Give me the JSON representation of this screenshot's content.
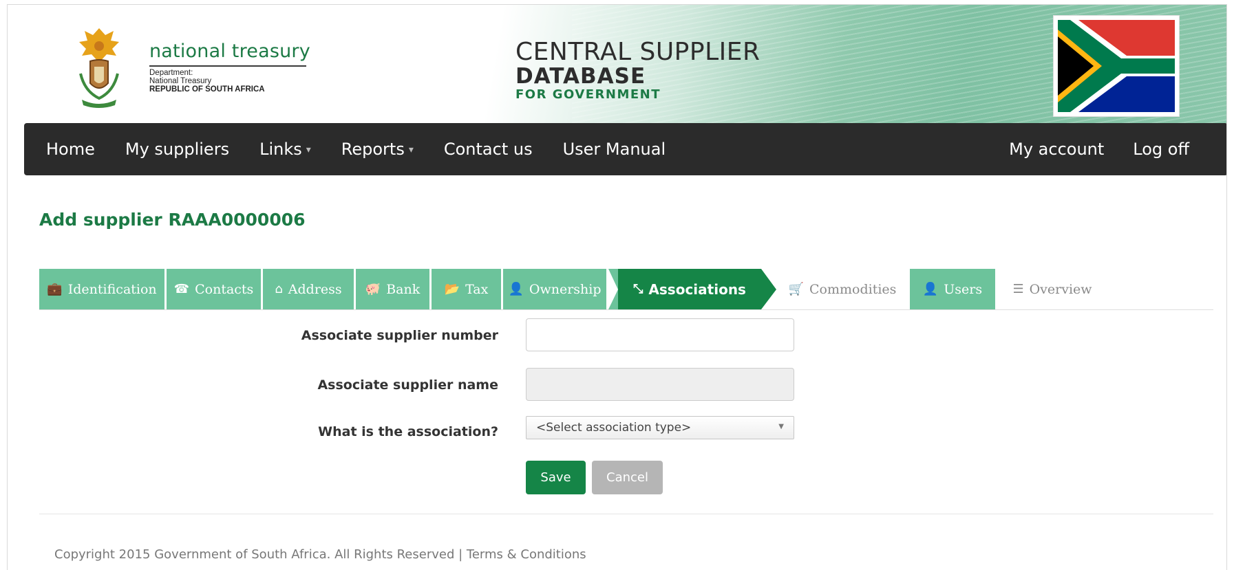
{
  "header": {
    "brand_name": "national treasury",
    "brand_line1": "Department:",
    "brand_line2": "National Treasury",
    "brand_line3": "REPUBLIC OF SOUTH AFRICA",
    "csd_line1": "CENTRAL SUPPLIER",
    "csd_line2": "DATABASE",
    "csd_line3": "FOR GOVERNMENT"
  },
  "nav": {
    "left": [
      {
        "label": "Home",
        "icon": ""
      },
      {
        "label": "My suppliers",
        "icon": ""
      },
      {
        "label": "Links",
        "icon": "caret-down-icon"
      },
      {
        "label": "Reports",
        "icon": "caret-down-icon"
      },
      {
        "label": "Contact us",
        "icon": ""
      },
      {
        "label": "User Manual",
        "icon": ""
      }
    ],
    "right": [
      {
        "label": "My account"
      },
      {
        "label": "Log off"
      }
    ]
  },
  "page_title": "Add supplier RAAA0000006",
  "tabs": [
    {
      "label": "Identification",
      "icon": "briefcase-icon",
      "glyph": "💼",
      "state": "complete"
    },
    {
      "label": "Contacts",
      "icon": "phone-icon",
      "glyph": "☎",
      "state": "complete"
    },
    {
      "label": "Address",
      "icon": "home-icon",
      "glyph": "⌂",
      "state": "complete"
    },
    {
      "label": "Bank",
      "icon": "piggy-bank-icon",
      "glyph": "🐖",
      "state": "complete"
    },
    {
      "label": "Tax",
      "icon": "folder-icon",
      "glyph": "📂",
      "state": "complete"
    },
    {
      "label": "Ownership",
      "icon": "user-icon",
      "glyph": "👤",
      "state": "complete"
    },
    {
      "label": "Associations",
      "icon": "compress-arrows-icon",
      "glyph": "⤡",
      "state": "active"
    },
    {
      "label": "Commodities",
      "icon": "cart-icon",
      "glyph": "🛒",
      "state": "pending"
    },
    {
      "label": "Users",
      "icon": "user-icon",
      "glyph": "👤",
      "state": "complete"
    },
    {
      "label": "Overview",
      "icon": "list-icon",
      "glyph": "☰",
      "state": "pending"
    }
  ],
  "form": {
    "supplier_number_label": "Associate supplier number",
    "supplier_number_value": "",
    "supplier_name_label": "Associate supplier name",
    "supplier_name_value": "",
    "association_label": "What is the association?",
    "association_selected": "<Select association type>",
    "save_label": "Save",
    "cancel_label": "Cancel"
  },
  "footer": {
    "text": "Copyright 2015 Government of South Africa. All Rights Reserved | Terms & Conditions"
  },
  "colors": {
    "brand_green": "#1c7a45",
    "tab_green": "#6cc39b",
    "active_green": "#158547",
    "navbar": "#2b2b2b"
  }
}
